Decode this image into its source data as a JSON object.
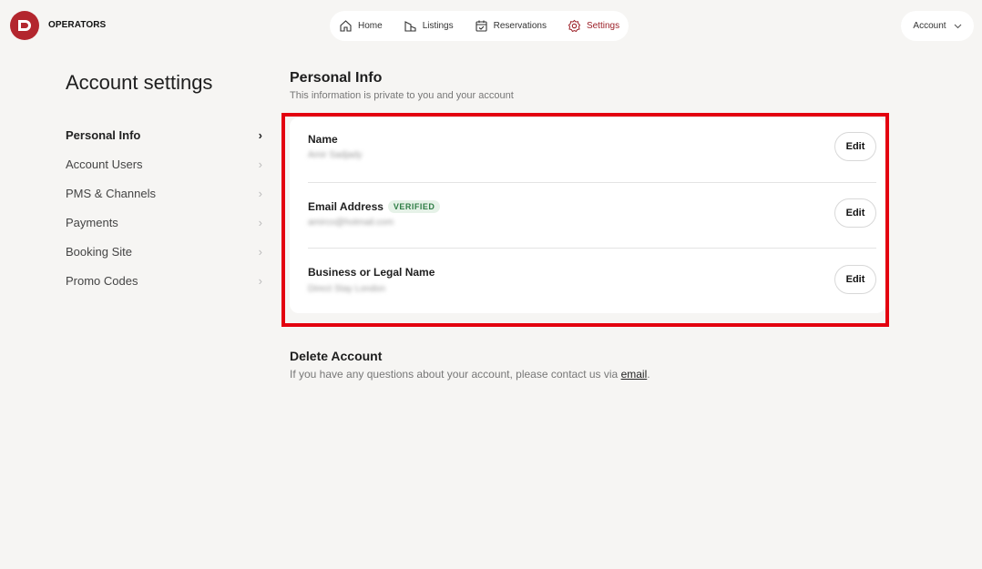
{
  "brand": {
    "name": "OPERATORS",
    "logo_letter": "D",
    "color": "#b3262e"
  },
  "nav": {
    "items": [
      {
        "label": "Home",
        "icon": "home-icon",
        "active": false
      },
      {
        "label": "Listings",
        "icon": "listings-icon",
        "active": false
      },
      {
        "label": "Reservations",
        "icon": "calendar-icon",
        "active": false
      },
      {
        "label": "Settings",
        "icon": "gear-icon",
        "active": true
      }
    ],
    "active_color": "#9c1f27"
  },
  "account_menu": {
    "label": "Account"
  },
  "sidebar": {
    "title": "Account settings",
    "items": [
      {
        "label": "Personal Info",
        "active": true
      },
      {
        "label": "Account Users",
        "active": false
      },
      {
        "label": "PMS & Channels",
        "active": false
      },
      {
        "label": "Payments",
        "active": false
      },
      {
        "label": "Booking Site",
        "active": false
      },
      {
        "label": "Promo Codes",
        "active": false
      }
    ]
  },
  "personal_info": {
    "title": "Personal Info",
    "subtitle": "This information is private to you and your account",
    "fields": [
      {
        "label": "Name",
        "value": "Amir Sadjady",
        "badge": "",
        "edit_label": "Edit"
      },
      {
        "label": "Email Address",
        "value": "amirco@hotmail.com",
        "badge": "VERIFIED",
        "edit_label": "Edit"
      },
      {
        "label": "Business or Legal Name",
        "value": "Direct Stay London",
        "badge": "",
        "edit_label": "Edit"
      }
    ]
  },
  "delete_account": {
    "title": "Delete Account",
    "text": "If you have any questions about your account, please contact us via",
    "link": "email",
    "suffix": "."
  },
  "highlight_color": "#e3000f"
}
